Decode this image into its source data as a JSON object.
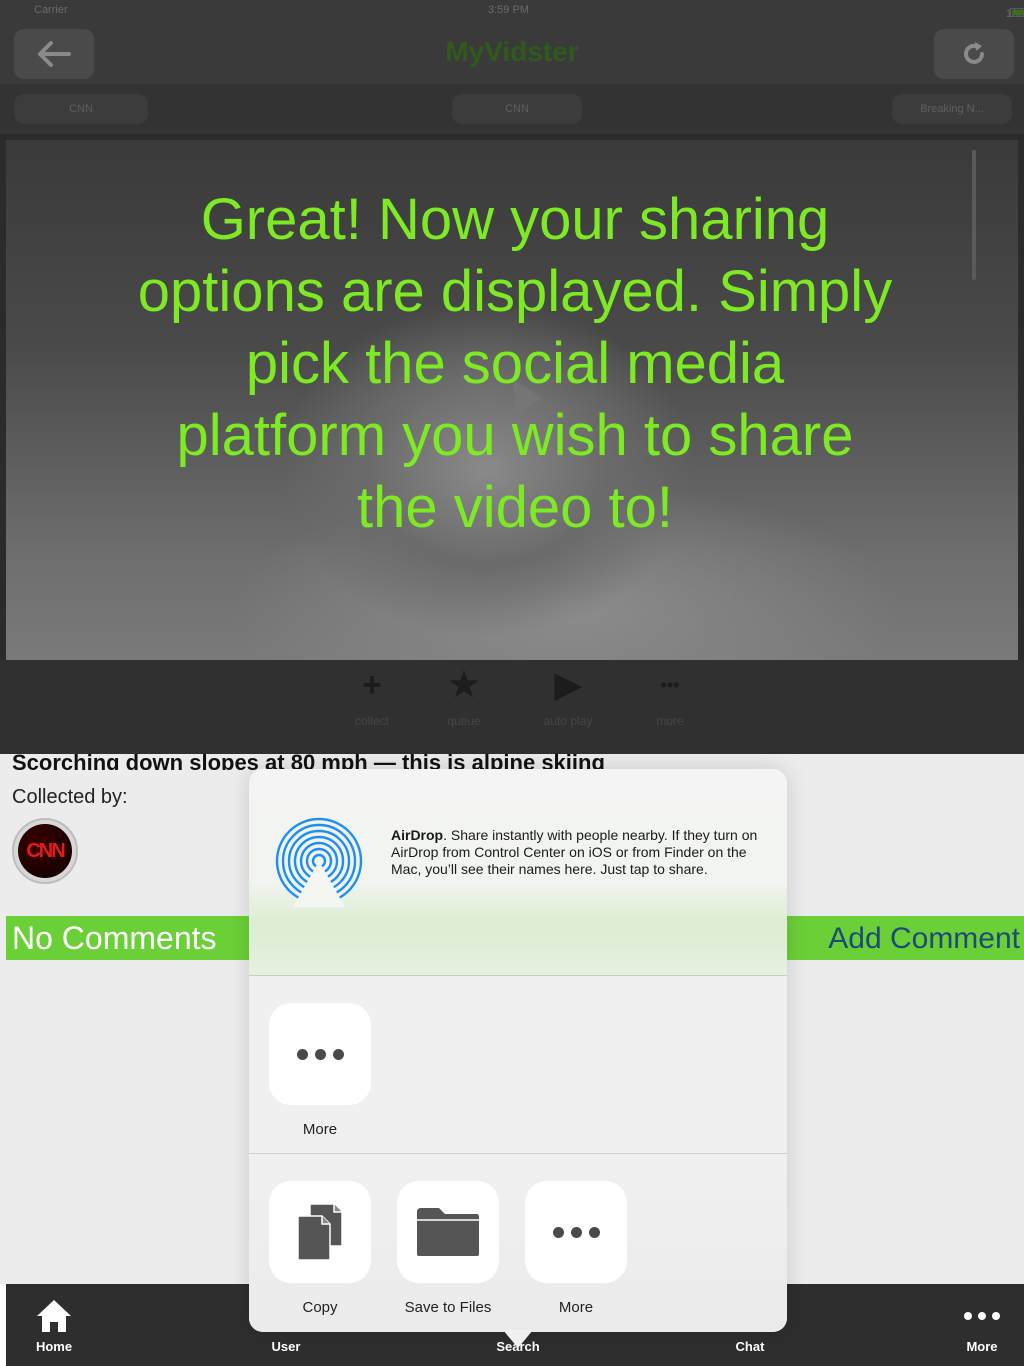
{
  "status_bar": {
    "carrier": "Carrier",
    "time": "3:59 PM",
    "battery": "100%"
  },
  "nav": {
    "title": "MyVidster"
  },
  "categories": [
    "CNN",
    "CNN",
    "Breaking N..."
  ],
  "actions": [
    {
      "glyph": "+",
      "label": "collect"
    },
    {
      "glyph": "★",
      "label": "queue"
    },
    {
      "glyph": "▶",
      "label": "auto play"
    },
    {
      "glyph": "•••",
      "label": "more"
    }
  ],
  "overlay": {
    "lines": [
      "Great! Now your sharing",
      "options are displayed. Simply",
      "pick the social media",
      "platform you wish to share",
      "the video to!"
    ]
  },
  "content": {
    "video_title": "Scorching down slopes at 80 mph — this is alpine skiing",
    "collected_by": "Collected by:",
    "collector_logo": "CNN",
    "no_comments": "No Comments",
    "add_comment": "Add Comment"
  },
  "share": {
    "airdrop_title": "AirDrop",
    "airdrop_desc": ". Share instantly with people nearby. If they turn on AirDrop from Control Center on iOS or from Finder on the Mac, you’ll see their names here. Just tap to share.",
    "apps": [
      {
        "label": "More",
        "icon": "more-icon"
      }
    ],
    "actions": [
      {
        "label": "Copy",
        "icon": "copy-icon"
      },
      {
        "label": "Save to Files",
        "icon": "folder-icon"
      },
      {
        "label": "More",
        "icon": "more-icon"
      }
    ]
  },
  "tabs": [
    {
      "label": "Home",
      "icon": "home-icon"
    },
    {
      "label": "User",
      "icon": "user-icon"
    },
    {
      "label": "Search",
      "icon": "search-icon"
    },
    {
      "label": "Chat",
      "icon": "chat-icon"
    },
    {
      "label": "More",
      "icon": "more-icon"
    }
  ],
  "colors": {
    "accent_green": "#6bd038",
    "overlay_text": "#7dea24",
    "add_comment_text": "#1d4b78",
    "airdrop_blue": "#1f8ef1"
  }
}
